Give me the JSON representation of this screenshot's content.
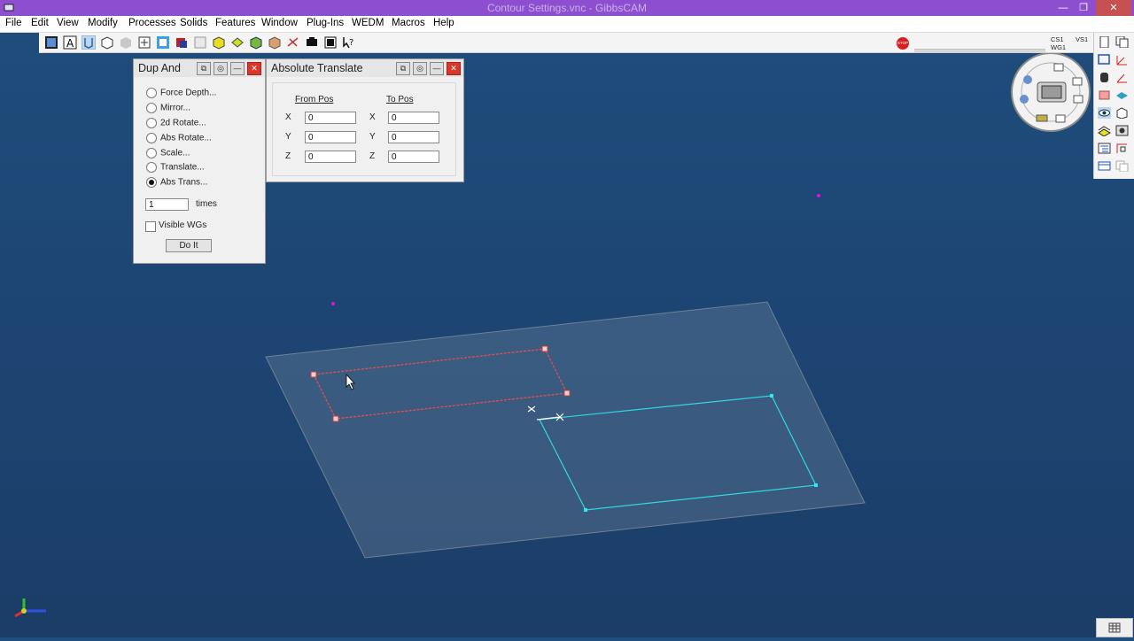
{
  "window": {
    "title": "Contour Settings.vnc - GibbsCAM",
    "minimize_glyph": "—",
    "restore_glyph": "❐",
    "close_glyph": "✕"
  },
  "menu": [
    "File",
    "Edit",
    "View",
    "Modify",
    "Processes",
    "Solids",
    "Features",
    "Window",
    "Plug-Ins",
    "WEDM",
    "Macros",
    "Help"
  ],
  "status": {
    "cs": "CS1",
    "wg": "WG1",
    "vs": "VS1",
    "stop_label": "STOP"
  },
  "dup_and": {
    "title": "Dup And",
    "options": [
      {
        "label": "Force Depth...",
        "selected": false
      },
      {
        "label": "Mirror...",
        "selected": false
      },
      {
        "label": "2d Rotate...",
        "selected": false
      },
      {
        "label": "Abs Rotate...",
        "selected": false
      },
      {
        "label": "Scale...",
        "selected": false
      },
      {
        "label": "Translate...",
        "selected": false
      },
      {
        "label": "Abs Trans...",
        "selected": true
      }
    ],
    "times_value": "1",
    "times_label": "times",
    "visible_wgs_label": "Visible WGs",
    "visible_wgs_checked": false,
    "do_it_label": "Do It"
  },
  "abs_translate": {
    "title": "Absolute Translate",
    "from_label": "From Pos",
    "to_label": "To Pos",
    "axes": [
      "X",
      "Y",
      "Z"
    ],
    "from": {
      "X": "0",
      "Y": "0",
      "Z": "0"
    },
    "to": {
      "X": "0",
      "Y": "0",
      "Z": "0"
    }
  },
  "colors": {
    "background": "#1f4a78",
    "selected_contour": "#e05050",
    "contour": "#30d8e0",
    "marker": "#e010e0"
  }
}
